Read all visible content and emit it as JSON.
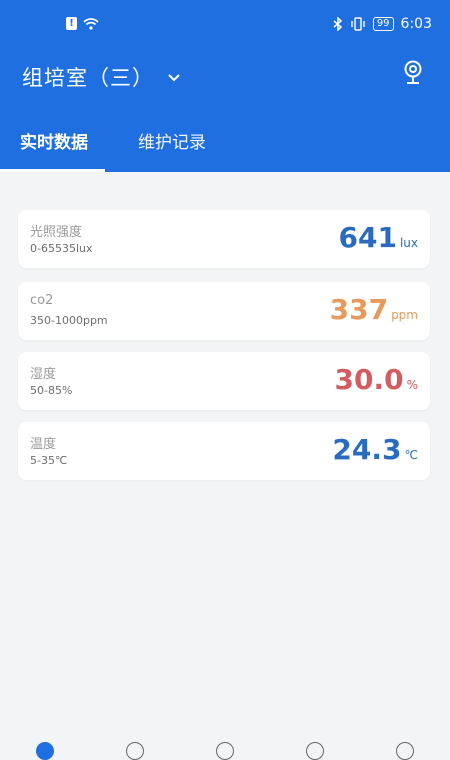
{
  "status_bar": {
    "time": "6:03",
    "battery": "99"
  },
  "header": {
    "title": "组培室（三）"
  },
  "tabs": [
    {
      "label": "实时数据",
      "active": true
    },
    {
      "label": "维护记录",
      "active": false
    }
  ],
  "metrics": [
    {
      "name": "光照强度",
      "range": "0-65535lux",
      "value": "641",
      "unit": "lux",
      "color": "#2a6bbf"
    },
    {
      "name": "co2",
      "range": "350-1000ppm",
      "value": "337",
      "unit": "ppm",
      "color": "#e79a5c"
    },
    {
      "name": "湿度",
      "range": "50-85%",
      "value": "30.0",
      "unit": "%",
      "color": "#d25c62"
    },
    {
      "name": "温度",
      "range": "5-35℃",
      "value": "24.3",
      "unit": "℃",
      "color": "#2a6bbf"
    }
  ],
  "colors": {
    "header_bg": "#1f6fe0",
    "page_bg": "#f3f4f6"
  },
  "icons": {
    "location": "map-pin-icon",
    "dropdown": "chevron-down-icon"
  }
}
